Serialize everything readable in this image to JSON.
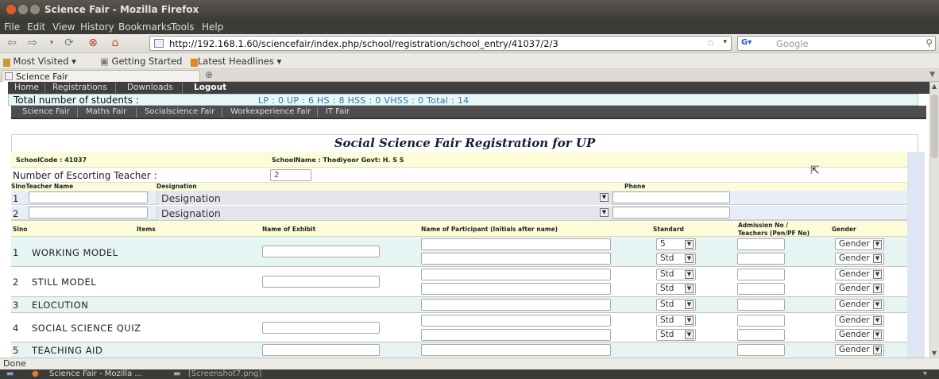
{
  "window": {
    "title": "Science Fair - Mozilla Firefox"
  },
  "menu": [
    "File",
    "Edit",
    "View",
    "History",
    "Bookmarks",
    "Tools",
    "Help"
  ],
  "toolbar": {
    "url": "http://192.168.1.60/sciencefair/index.php/school/registration/school_entry/41037/2/3",
    "search_placeholder": "Google"
  },
  "bookmarks": [
    "Most Visited",
    "Getting Started",
    "Latest Headlines"
  ],
  "tab": {
    "label": "Science Fair"
  },
  "site_nav": [
    "Home",
    "Registrations",
    "Downloads",
    "Logout"
  ],
  "counts": {
    "label": "Total number of students :",
    "value": "LP : 0 UP : 6 HS : 8 HSS : 0 VHSS : 0 Total : 14"
  },
  "fair_nav": [
    "Science Fair",
    "Maths Fair",
    "Socialscience Fair",
    "Workexperience Fair",
    "IT Fair"
  ],
  "form": {
    "title": "Social Science Fair Registration for UP",
    "school_code": "SchoolCode : 41037",
    "school_name": "SchoolName : Thodiyoor Govt: H. S S",
    "escort_label": "Number of Escorting Teacher :",
    "escort_value": "2"
  },
  "teacher_table": {
    "headers": {
      "sino": "SlnoTeacher Name",
      "designation": "Designation",
      "phone": "Phone"
    },
    "rows": [
      {
        "no": "1",
        "designation": "Designation"
      },
      {
        "no": "2",
        "designation": "Designation"
      }
    ]
  },
  "items_table": {
    "headers": {
      "sino": "Slno",
      "items": "Items",
      "exhibit": "Name of Exhibit",
      "participant": "Name of Participant (Initials after name)",
      "standard": "Standard",
      "admission_1": "Admission No /",
      "admission_2": "Teachers (Pen/PF No)",
      "gender": "Gender"
    },
    "rows": [
      {
        "no": "1",
        "name": "WORKING MODEL",
        "std": [
          "5",
          "Std"
        ],
        "gender": [
          "Gender",
          "Gender"
        ]
      },
      {
        "no": "2",
        "name": "STILL MODEL",
        "std": [
          "Std",
          "Std"
        ],
        "gender": [
          "Gender",
          "Gender"
        ]
      },
      {
        "no": "3",
        "name": "ELOCUTION",
        "std": [
          "Std"
        ],
        "gender": [
          "Gender"
        ]
      },
      {
        "no": "4",
        "name": "SOCIAL SCIENCE QUIZ",
        "std": [
          "Std",
          "Std"
        ],
        "gender": [
          "Gender",
          "Gender"
        ]
      },
      {
        "no": "5",
        "name": "TEACHING AID",
        "std": [],
        "gender": [
          "Gender"
        ]
      }
    ]
  },
  "status": "Done",
  "taskbar": [
    "Science Fair - Mozilla ...",
    "[Screenshot7.png]"
  ]
}
